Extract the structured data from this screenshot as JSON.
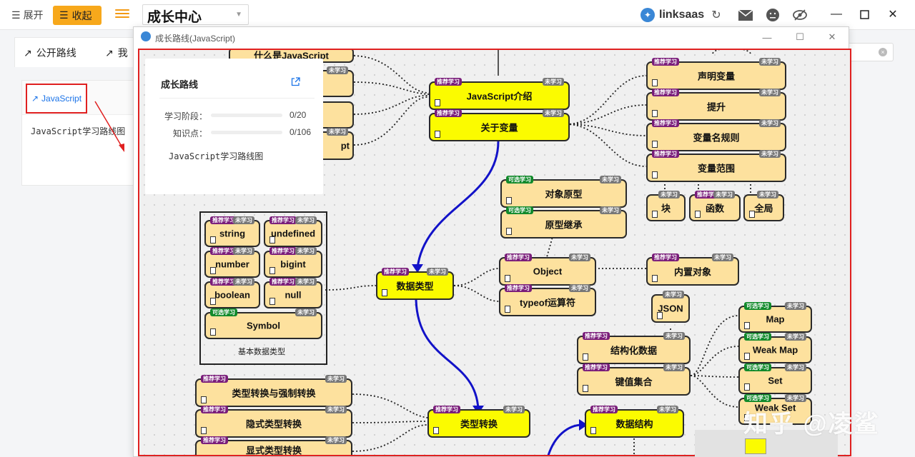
{
  "topbar": {
    "expand_label": "展开",
    "collapse_label": "收起",
    "title": "成长中心",
    "brand": "linksaas"
  },
  "background": {
    "tabs": [
      {
        "label": "公开路线"
      },
      {
        "label": "我"
      }
    ],
    "route_link_label": "JavaScript",
    "route_desc": "JavaScript学习路线图"
  },
  "modal": {
    "title": "成长路线(JavaScript)"
  },
  "info_panel": {
    "title": "成长路线",
    "stage_label": "学习阶段：",
    "stage_progress": 0,
    "stage_value": "0/20",
    "knowledge_label": "知识点：",
    "knowledge_progress": 0,
    "knowledge_value": "0/106",
    "description": "JavaScript学习路线图"
  },
  "badges": {
    "recommended": "推荐学习",
    "optional": "可选学习",
    "unlearned": "未学习"
  },
  "nodes": {
    "what_is_js": "什么是JavaScript",
    "js_partial": "pt",
    "js_intro": "JavaScript介绍",
    "about_vars": "关于变量",
    "declare_vars": "声明变量",
    "hoisting": "提升",
    "naming_rules": "变量名规则",
    "var_scope": "变量范围",
    "block": "块",
    "function": "函数",
    "global": "全局",
    "obj_proto": "对象原型",
    "proto_inherit": "原型继承",
    "data_types": "数据类型",
    "object": "Object",
    "typeof_op": "typeof运算符",
    "builtin_objects": "内置对象",
    "json": "JSON",
    "string": "string",
    "undefined": "undefined",
    "number": "number",
    "bigint": "bigint",
    "boolean": "boolean",
    "null": "null",
    "symbol": "Symbol",
    "primitive_caption": "基本数据类型",
    "structured_data": "结构化数据",
    "keyed_collections": "键值集合",
    "map": "Map",
    "weakmap": "Weak Map",
    "set": "Set",
    "weakset": "Weak Set",
    "type_conv_forced": "类型转换与强制转换",
    "implicit_conv": "隐式类型转换",
    "explicit_conv": "显式类型转换",
    "type_conversion": "类型转换",
    "data_structures": "数据结构"
  },
  "watermark": "知乎 @凌鲨",
  "colors": {
    "accent_orange": "#f7a81b",
    "highlight_red": "#e02020",
    "node_yellow": "#fbfb00",
    "node_orange": "#fde19e",
    "flow_blue": "#1212c8",
    "badge_recommended": "#7a1d7a",
    "badge_optional": "#118a2b",
    "badge_unlearned": "#777777"
  }
}
